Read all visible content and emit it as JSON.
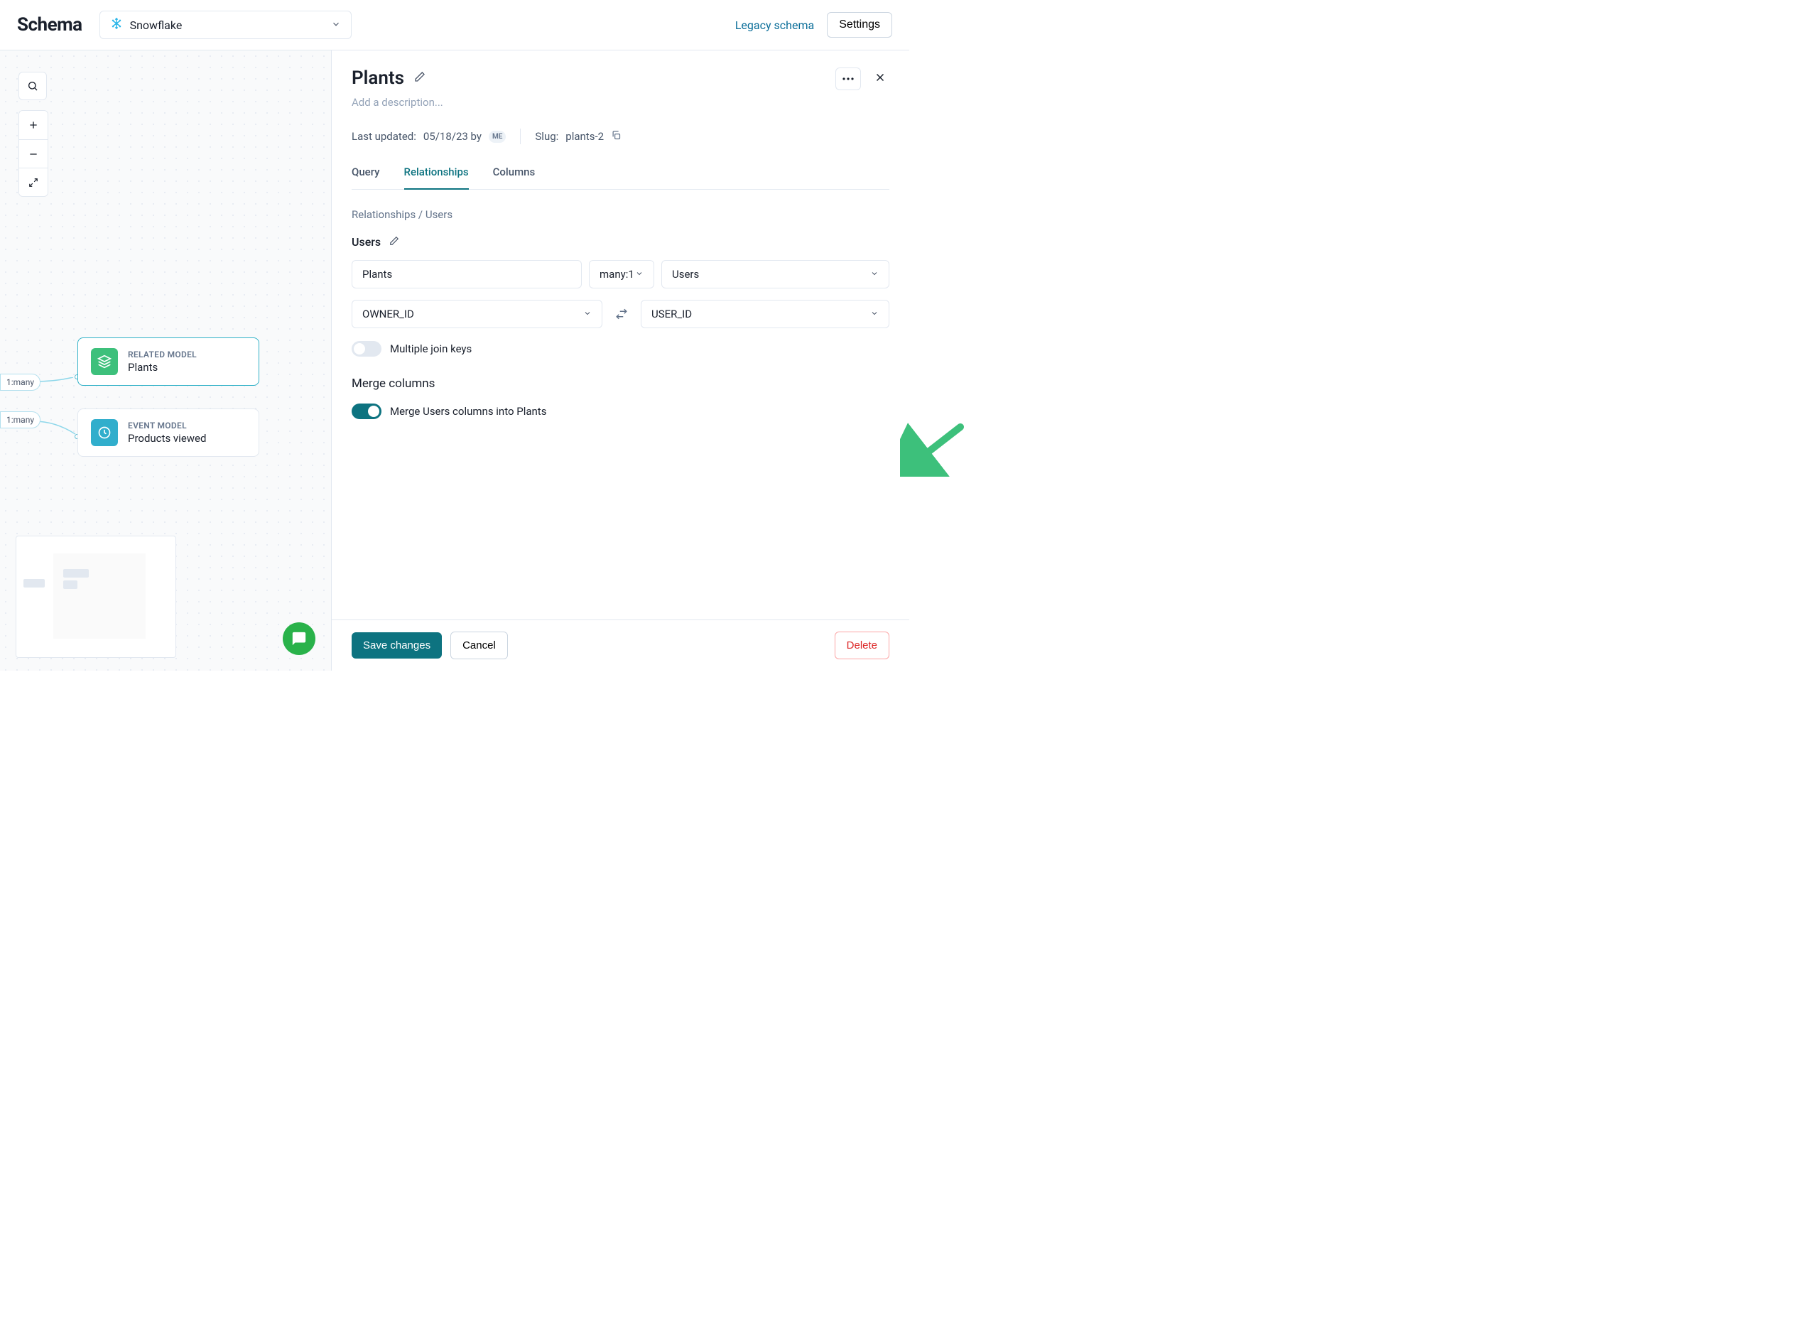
{
  "header": {
    "logo": "Schema",
    "source": "Snowflake",
    "legacy_link": "Legacy schema",
    "settings": "Settings"
  },
  "canvas": {
    "edges": [
      {
        "label": "1:many"
      },
      {
        "label": "1:many"
      }
    ],
    "nodes": [
      {
        "kind": "RELATED MODEL",
        "name": "Plants",
        "icon": "layers",
        "color": "green",
        "selected": true
      },
      {
        "kind": "EVENT MODEL",
        "name": "Products viewed",
        "icon": "clock",
        "color": "teal",
        "selected": false
      }
    ]
  },
  "panel": {
    "title": "Plants",
    "description_placeholder": "Add a description...",
    "meta": {
      "last_updated_label": "Last updated:",
      "last_updated_value": "05/18/23 by",
      "avatar": "ME",
      "slug_label": "Slug:",
      "slug_value": "plants-2"
    },
    "tabs": {
      "query": "Query",
      "relationships": "Relationships",
      "columns": "Columns",
      "active": "relationships"
    },
    "breadcrumb": "Relationships  /  Users",
    "subtitle": "Users",
    "config": {
      "source_model": "Plants",
      "cardinality": "many:1",
      "target_model": "Users",
      "source_key": "OWNER_ID",
      "target_key": "USER_ID"
    },
    "toggles": {
      "multiple_keys": {
        "label": "Multiple join keys",
        "on": false
      },
      "merge_section": "Merge columns",
      "merge": {
        "label": "Merge Users columns into Plants",
        "on": true
      }
    }
  },
  "footer": {
    "save": "Save changes",
    "cancel": "Cancel",
    "delete": "Delete"
  }
}
